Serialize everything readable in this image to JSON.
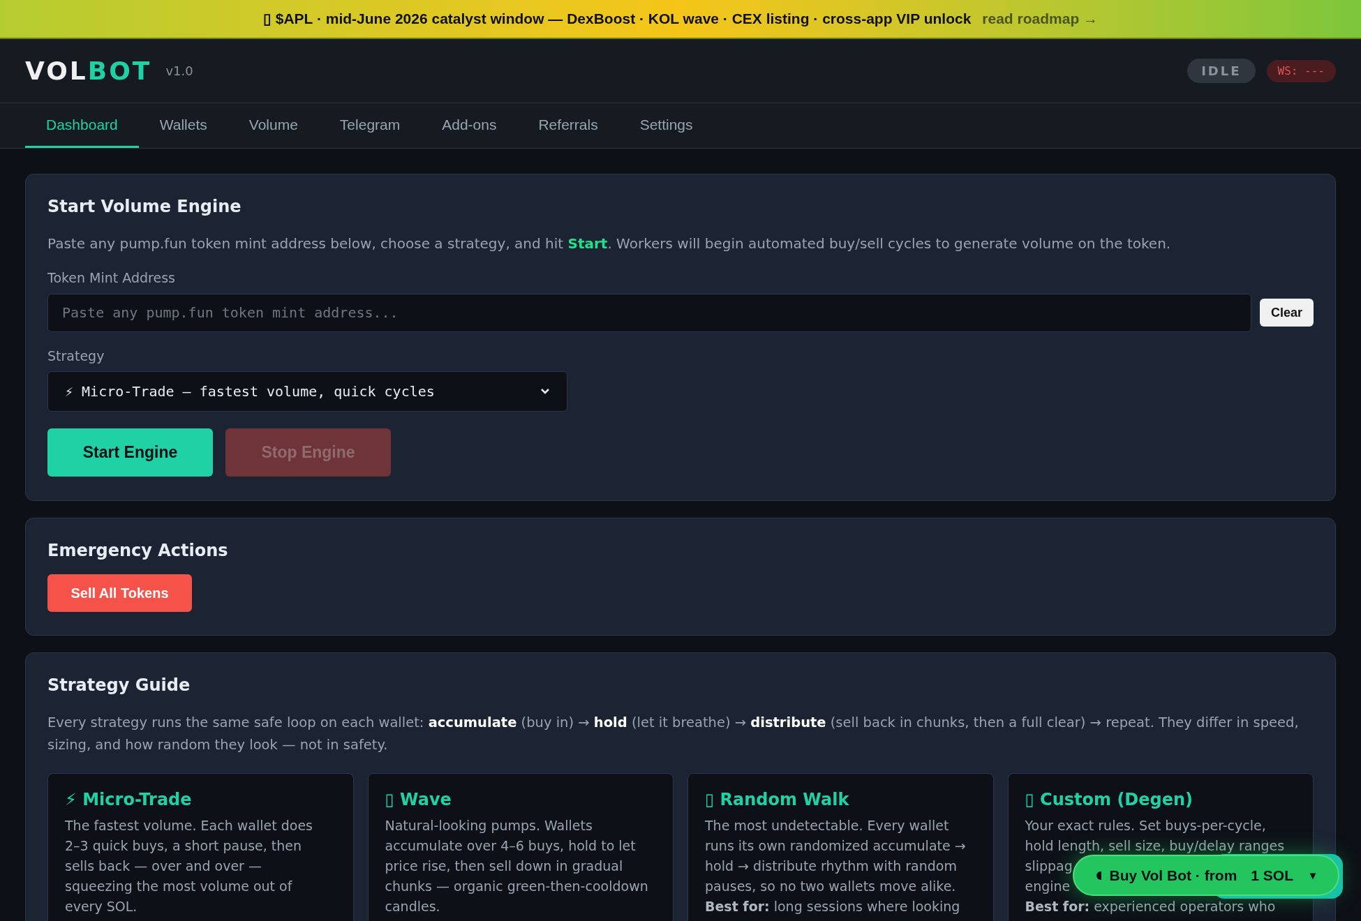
{
  "banner": {
    "icon": "▯",
    "text": "$APL · mid-June 2026 catalyst window — DexBoost · KOL wave · CEX listing · cross-app VIP unlock",
    "link": "read roadmap →"
  },
  "header": {
    "logo_a": "VOL",
    "logo_b": "BOT",
    "version": "v1.0",
    "status": "IDLE",
    "ws": "WS: ---"
  },
  "tabs": [
    {
      "label": "Dashboard",
      "selected": true
    },
    {
      "label": "Wallets",
      "selected": false
    },
    {
      "label": "Volume",
      "selected": false
    },
    {
      "label": "Telegram",
      "selected": false
    },
    {
      "label": "Add-ons",
      "selected": false
    },
    {
      "label": "Referrals",
      "selected": false
    },
    {
      "label": "Settings",
      "selected": false
    }
  ],
  "engine": {
    "title": "Start Volume Engine",
    "intro": "Paste any pump.fun token mint address below, choose a strategy, and hit **Start**. Workers will begin automated buy/sell cycles to generate volume on the token.",
    "mint_label": "Token Mint Address",
    "mint_placeholder": "Paste any pump.fun token mint address...",
    "clear": "Clear",
    "strategy_label": "Strategy",
    "strategy_value": "⚡ Micro-Trade — fastest volume, quick cycles",
    "start": "Start Engine",
    "stop": "Stop Engine",
    "stop_disabled": true
  },
  "emergency": {
    "title": "Emergency Actions",
    "button": "Sell All Tokens"
  },
  "guide": {
    "title": "Strategy Guide",
    "intro": "Every strategy runs the same safe loop on each wallet: **accumulate** (buy in) → **hold** (let it breathe) → **distribute** (sell back in chunks, then a full clear) → repeat. They differ in speed, sizing, and how random they look — not in safety.",
    "cards": [
      {
        "icon": "⚡",
        "title": "Micro-Trade",
        "lines": [
          "The fastest volume. Each wallet does",
          "2–3 quick buys, a short pause, then",
          "sells back — over and over —",
          "squeezing the most volume out of",
          "every SOL."
        ]
      },
      {
        "icon": "▯",
        "title": "Wave",
        "lines": [
          "Natural-looking pumps. Wallets",
          "accumulate over 4–6 buys, hold to let",
          "price rise, then sell down in gradual",
          "chunks — organic green-then-cooldown",
          "candles."
        ]
      },
      {
        "icon": "▯",
        "title": "Random Walk",
        "lines": [
          "The most undetectable. Every wallet",
          "runs its own randomized accumulate →",
          "hold → distribute rhythm with random",
          "pauses, so no two wallets move alike.",
          "**Best for:** long sessions where looking"
        ]
      },
      {
        "icon": "▯",
        "title": "Custom (Degen)",
        "lines": [
          "Your exact rules. Set buys-per-cycle,",
          "hold length, sell size, buy/delay ranges",
          "slippag",
          "engine",
          "**Best for:** experienced operators who"
        ]
      }
    ]
  },
  "floating": {
    "label": "Buy Vol Bot · from",
    "price": "1 SOL",
    "caret": "▾"
  }
}
